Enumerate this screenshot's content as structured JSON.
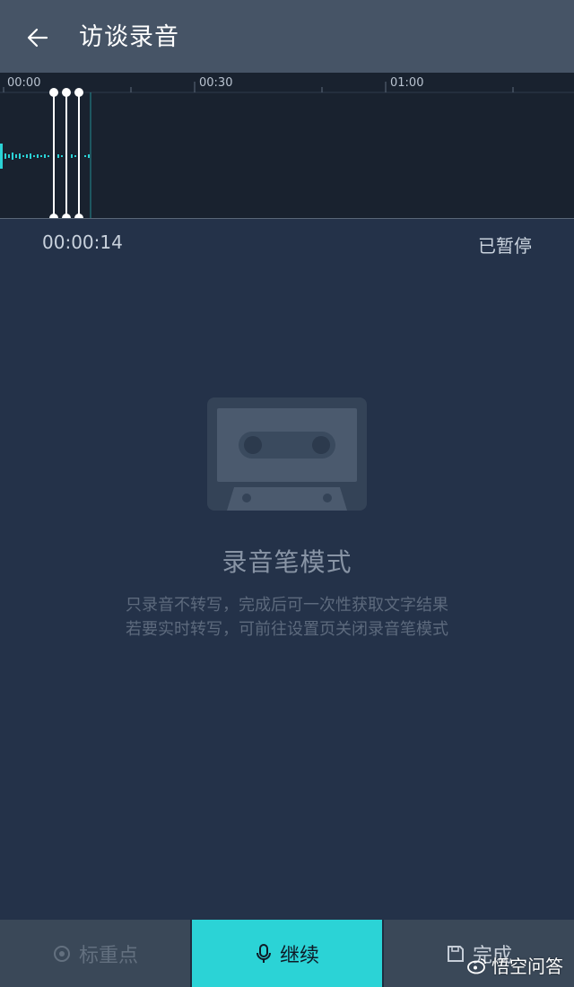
{
  "header": {
    "title": "访谈录音",
    "back_icon": "arrow-left-icon"
  },
  "timeline": {
    "tick_labels": [
      "00:00",
      "00:30",
      "01:00"
    ],
    "playhead_color": "#2bd3d6"
  },
  "recording": {
    "elapsed": "00:00:14",
    "status": "已暂停"
  },
  "empty_state": {
    "icon": "cassette-tape-icon",
    "title": "录音笔模式",
    "line1": "只录音不转写，完成后可一次性获取文字结果",
    "line2": "若要实时转写，可前往设置页关闭录音笔模式"
  },
  "actions": {
    "mark": {
      "label": "标重点",
      "icon": "target-icon"
    },
    "continue": {
      "label": "继续",
      "icon": "microphone-icon"
    },
    "done": {
      "label": "完成",
      "icon": "save-icon"
    }
  },
  "watermark": {
    "text": "悟空问答"
  },
  "colors": {
    "accent": "#2bd3d6",
    "background": "#243249",
    "header": "#465466"
  }
}
